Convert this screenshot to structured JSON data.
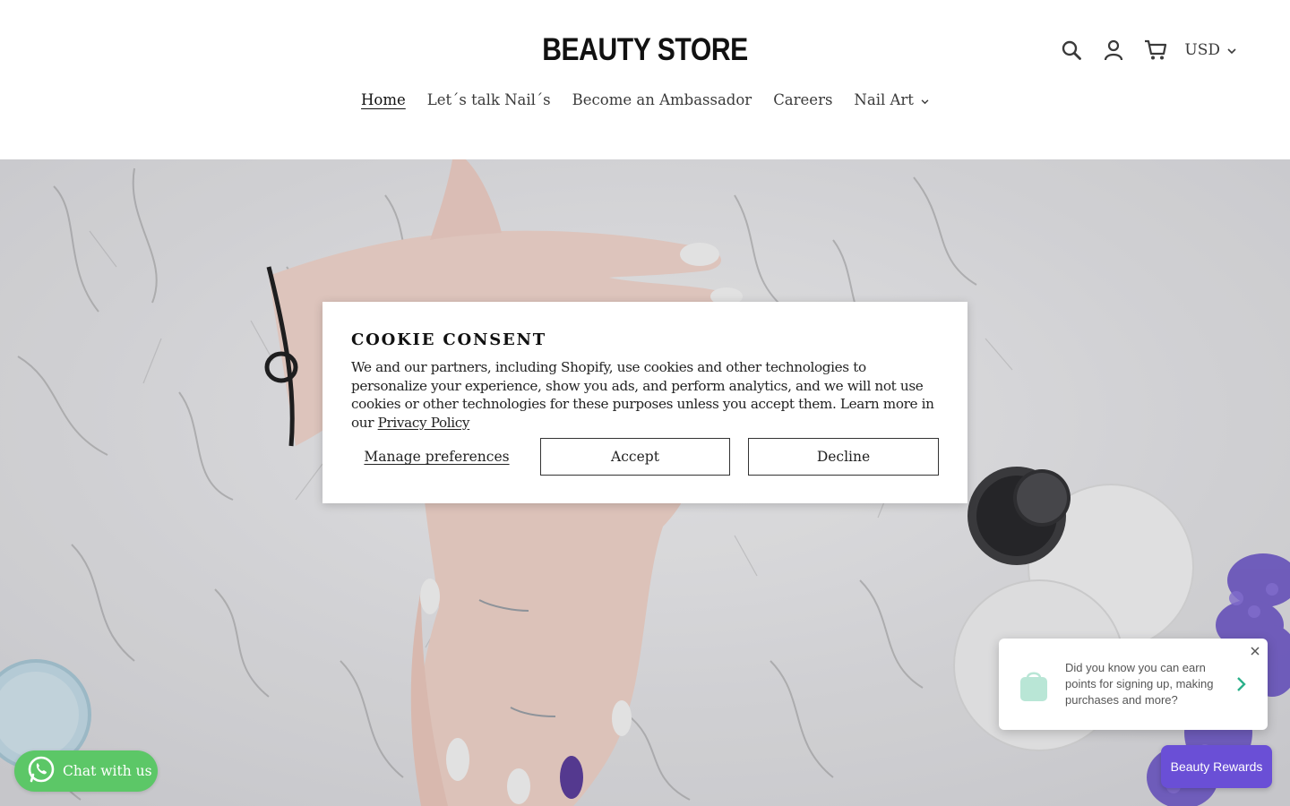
{
  "brand": {
    "logo_text": "BEAUTY STORE"
  },
  "header": {
    "currency": "USD",
    "icons": [
      "search-icon",
      "account-icon",
      "cart-icon"
    ]
  },
  "nav": {
    "items": [
      {
        "label": "Home",
        "active": true
      },
      {
        "label": "Let´s talk Nail´s"
      },
      {
        "label": "Become an Ambassador"
      },
      {
        "label": "Careers"
      },
      {
        "label": "Nail Art",
        "has_dropdown": true
      }
    ]
  },
  "cookie": {
    "title": "COOKIE CONSENT",
    "body": "We and our partners, including Shopify, use cookies and other technologies to personalize your experience, show you ads, and perform analytics, and we will not use cookies or other technologies for these purposes unless you accept them. Learn more in our",
    "policy_link": "Privacy Policy",
    "manage_label": "Manage preferences",
    "accept_label": "Accept",
    "decline_label": "Decline"
  },
  "chat": {
    "label": "Chat with us",
    "color": "#5cc767"
  },
  "rewards": {
    "popup_text": "Did you know you can earn points for signing up, making purchases and more?",
    "button_label": "Beauty Rewards",
    "color": "#6a4fd6"
  }
}
